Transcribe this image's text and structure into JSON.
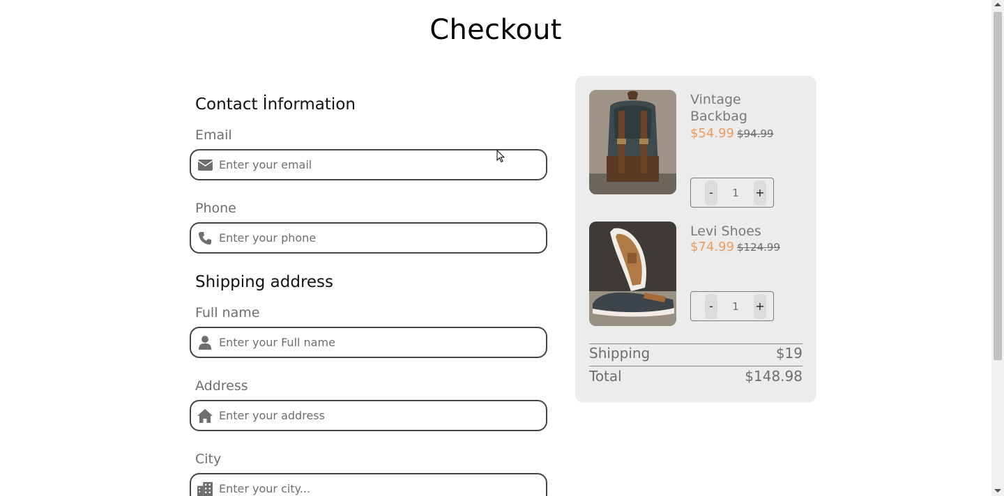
{
  "page": {
    "title": "Checkout"
  },
  "contact": {
    "heading": "Contact İnformation",
    "email": {
      "label": "Email",
      "placeholder": "Enter your email",
      "icon": "envelope-icon"
    },
    "phone": {
      "label": "Phone",
      "placeholder": "Enter your phone",
      "icon": "phone-icon"
    }
  },
  "shipping": {
    "heading": "Shipping address",
    "full_name": {
      "label": "Full name",
      "placeholder": "Enter your Full name",
      "icon": "user-icon"
    },
    "address": {
      "label": "Address",
      "placeholder": "Enter your address",
      "icon": "home-icon"
    },
    "city": {
      "label": "City",
      "placeholder": "Enter your city...",
      "icon": "building-icon"
    }
  },
  "cart": {
    "items": [
      {
        "name": "Vintage Backbag",
        "price": "$54.99",
        "old_price": "$94.99",
        "quantity": "1",
        "minus": "-",
        "plus": "+",
        "image": "backpack-photo"
      },
      {
        "name": "Levi Shoes",
        "price": "$74.99",
        "old_price": "$124.99",
        "quantity": "1",
        "minus": "-",
        "plus": "+",
        "image": "shoes-photo"
      }
    ],
    "shipping_label": "Shipping",
    "shipping_value": "$19",
    "total_label": "Total",
    "total_value": "$148.98"
  },
  "colors": {
    "accent_price": "#ec9b5b",
    "panel_bg": "#ececec",
    "text_muted": "#6e6e6e"
  }
}
